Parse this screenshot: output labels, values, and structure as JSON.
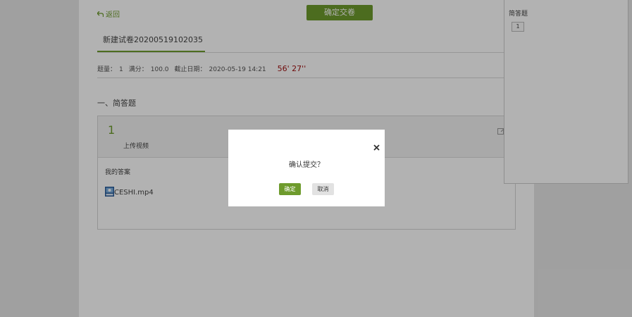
{
  "header": {
    "back_label": "返回",
    "submit_label": "确定交卷"
  },
  "exam": {
    "title": "新建试卷20200519102035",
    "count_label": "题量：",
    "count_value": "1",
    "score_label": "满分：",
    "score_value": "100.0",
    "deadline_label": "截止日期：",
    "deadline_value": "2020-05-19 14:21",
    "timer": "56' 27''"
  },
  "section": {
    "title": "一、简答题"
  },
  "question": {
    "number": "1",
    "text": "上传视频",
    "answer_label": "我的答案",
    "attachment_name": "CESHI.mp4"
  },
  "side_panel": {
    "title": "简答题",
    "items": [
      "1"
    ]
  },
  "dialog": {
    "message": "确认提交？",
    "ok_label": "确定",
    "cancel_label": "取消"
  },
  "colors": {
    "accent": "#6e9b2d",
    "timer": "#a01010"
  }
}
